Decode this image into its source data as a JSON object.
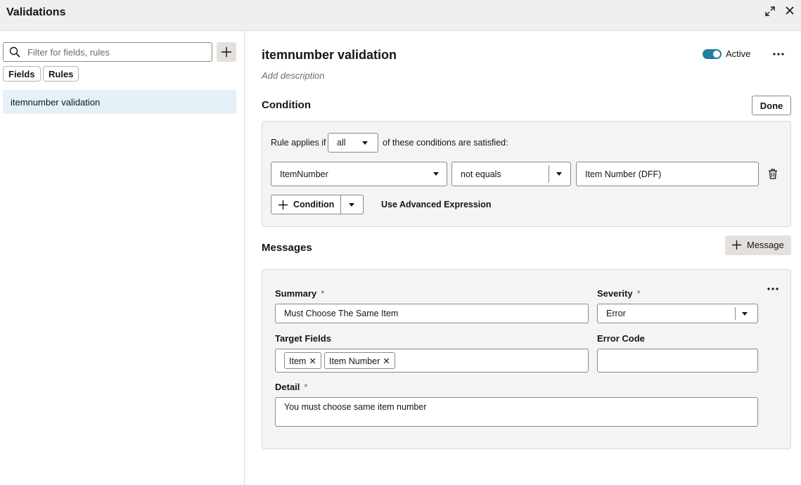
{
  "window": {
    "title": "Validations"
  },
  "sidebar": {
    "search_placeholder": "Filter for fields, rules",
    "filters": [
      "Fields",
      "Rules"
    ],
    "items": [
      {
        "label": "itemnumber validation",
        "selected": true
      }
    ]
  },
  "rule": {
    "name": "itemnumber validation",
    "description_placeholder": "Add description",
    "active_label": "Active",
    "active": true
  },
  "condition": {
    "heading": "Condition",
    "done_label": "Done",
    "applies_prefix": "Rule applies if",
    "applies_value": "all",
    "applies_suffix": "of these conditions are satisfied:",
    "rows": [
      {
        "field": "ItemNumber",
        "operator": "not equals",
        "value": "Item Number (DFF)"
      }
    ],
    "add_condition_label": "Condition",
    "advanced_label": "Use Advanced Expression"
  },
  "messages": {
    "heading": "Messages",
    "add_message_label": "Message",
    "summary_label": "Summary",
    "summary_value": "Must Choose The Same Item",
    "severity_label": "Severity",
    "severity_value": "Error",
    "target_fields_label": "Target Fields",
    "target_fields": [
      "Item",
      "Item Number"
    ],
    "error_code_label": "Error Code",
    "error_code_value": "",
    "detail_label": "Detail",
    "detail_value": "You must choose same item number",
    "required_mark": "*"
  },
  "colors": {
    "accent": "#227e9e",
    "selected_bg": "#e4f1f7",
    "header_bg": "#f1efed",
    "panel_bg": "#f5f4f2"
  },
  "icons": [
    "expand-icon",
    "close-icon",
    "search-icon",
    "plus-icon",
    "more-icon",
    "chevron-down-icon",
    "trash-icon",
    "remove-tag-icon"
  ]
}
